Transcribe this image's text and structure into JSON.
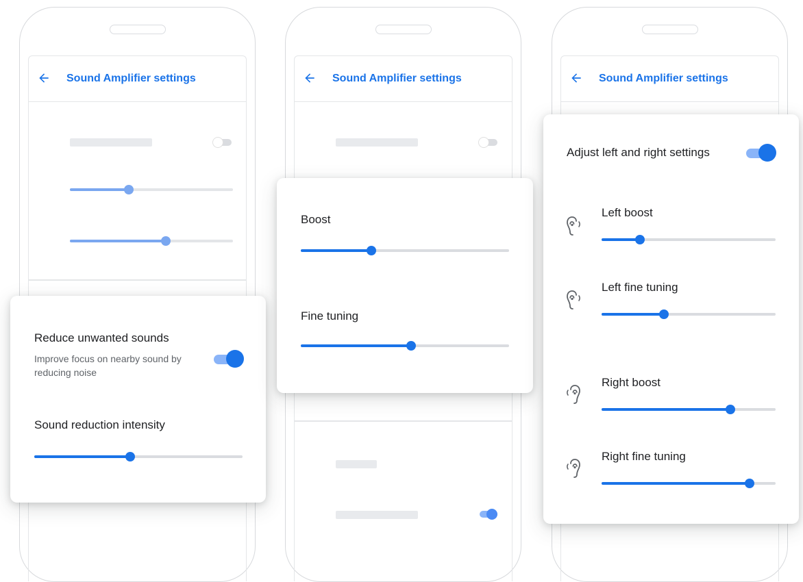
{
  "appbar": {
    "title": "Sound Amplifier settings",
    "back_icon": "back-arrow-icon"
  },
  "colors": {
    "accent": "#1a73e8",
    "accent_light": "#8ab4f8",
    "track": "#dadce0",
    "placeholder": "#e8eaed"
  },
  "panel1": {
    "reduce": {
      "title": "Reduce unwanted sounds",
      "description": "Improve focus on nearby sound by reducing noise",
      "enabled": true
    },
    "intensity": {
      "label": "Sound reduction intensity",
      "value": 0.46
    },
    "background_sliders": [
      0.36,
      0.59
    ]
  },
  "panel2": {
    "boost": {
      "label": "Boost",
      "value": 0.34
    },
    "fine_tuning": {
      "label": "Fine tuning",
      "value": 0.53
    }
  },
  "panel3": {
    "adjust": {
      "label": "Adjust left and right settings",
      "enabled": true
    },
    "sliders": [
      {
        "label": "Left boost",
        "icon": "left-ear-icon",
        "value": 0.22
      },
      {
        "label": "Left fine tuning",
        "icon": "left-ear-icon",
        "value": 0.36
      },
      {
        "label": "Right boost",
        "icon": "right-ear-icon",
        "value": 0.74
      },
      {
        "label": "Right fine tuning",
        "icon": "right-ear-icon",
        "value": 0.85
      }
    ]
  }
}
